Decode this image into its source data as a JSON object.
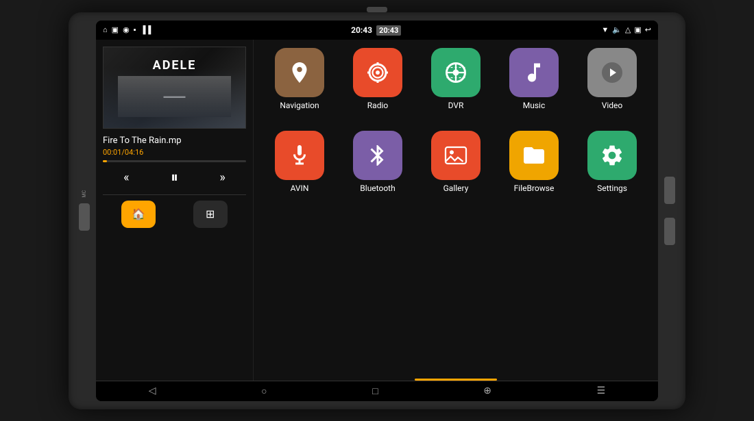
{
  "device": {
    "status_bar": {
      "time": "20:43",
      "left_icons": [
        "⌂",
        "▣",
        "◉",
        "▪",
        "▐▐"
      ],
      "right_icons": [
        "▼",
        "▷",
        "△",
        "▣",
        "↩"
      ]
    },
    "music_player": {
      "artist": "ADELE",
      "subtitle": "",
      "track_name": "Fire To The Rain.mp",
      "track_time": "00:01/04:16",
      "progress_percent": 3,
      "controls": {
        "prev": "«",
        "play": "⏸",
        "next": "»"
      },
      "bottom_buttons": [
        {
          "label": "home",
          "icon": "🏠",
          "active": true
        },
        {
          "label": "apps",
          "icon": "⊞",
          "active": false
        }
      ]
    },
    "apps": {
      "row1": [
        {
          "label": "Navigation",
          "color": "nav-icon",
          "icon": "nav"
        },
        {
          "label": "Radio",
          "color": "radio-icon",
          "icon": "radio"
        },
        {
          "label": "DVR",
          "color": "dvr-icon",
          "icon": "dvr"
        },
        {
          "label": "Music",
          "color": "music-icon",
          "icon": "music"
        },
        {
          "label": "Video",
          "color": "video-icon",
          "icon": "video"
        }
      ],
      "row2": [
        {
          "label": "AVIN",
          "color": "avin-icon",
          "icon": "avin"
        },
        {
          "label": "Bluetooth",
          "color": "bluetooth-icon",
          "icon": "bt"
        },
        {
          "label": "Gallery",
          "color": "gallery-icon",
          "icon": "gallery"
        },
        {
          "label": "FileBrowse",
          "color": "filebrowse-icon",
          "icon": "file"
        },
        {
          "label": "Settings",
          "color": "settings-icon",
          "icon": "settings"
        }
      ]
    },
    "nav_bar": {
      "buttons": [
        "◁",
        "○",
        "□",
        "⊕",
        "☰"
      ]
    }
  }
}
